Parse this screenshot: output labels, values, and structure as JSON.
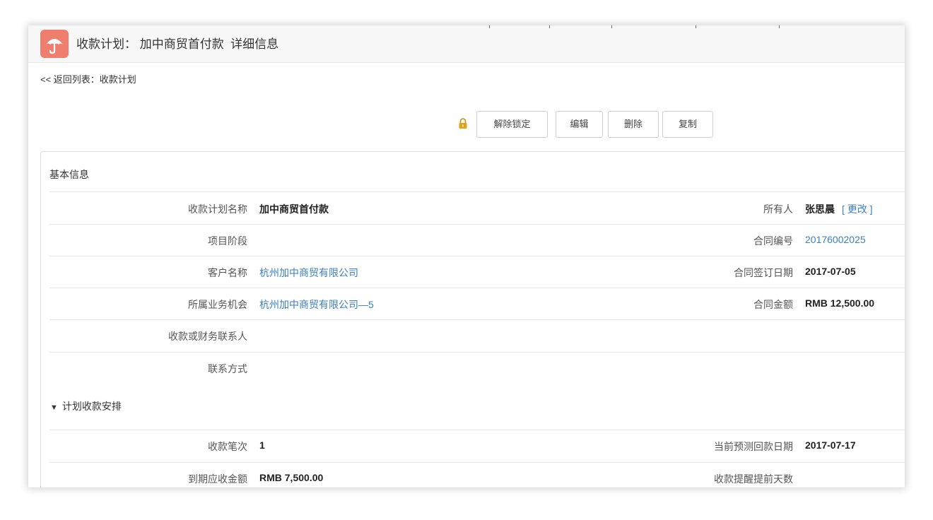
{
  "page": {
    "title": "收款计划： 加中商贸首付款  详细信息",
    "back_link": "<< 返回列表：收款计划"
  },
  "toolbar": {
    "unlock_label": "解除锁定",
    "edit_label": "编辑",
    "delete_label": "删除",
    "copy_label": "复制"
  },
  "basic_info": {
    "title": "基本信息",
    "plan_name_label": "收款计划名称",
    "plan_name_value": "加中商贸首付款",
    "owner_label": "所有人",
    "owner_value": "张思晨",
    "owner_change": "[ 更改 ]",
    "stage_label": "项目阶段",
    "stage_value": "",
    "contract_no_label": "合同编号",
    "contract_no_value": "20176002025",
    "customer_label": "客户名称",
    "customer_value": "杭州加中商贸有限公司",
    "sign_date_label": "合同签订日期",
    "sign_date_value": "2017-07-05",
    "opportunity_label": "所属业务机会",
    "opportunity_value": "杭州加中商贸有限公司—5",
    "amount_label": "合同金额",
    "amount_value": "RMB 12,500.00",
    "contact_label": "收款或财务联系人",
    "contact_value": "",
    "contact_method_label": "联系方式",
    "contact_method_value": ""
  },
  "schedule": {
    "title": "计划收款安排",
    "installment_label": "收款笔次",
    "installment_value": "1",
    "forecast_date_label": "当前预测回款日期",
    "forecast_date_value": "2017-07-17",
    "due_amount_label": "到期应收金额",
    "due_amount_value": "RMB 7,500.00",
    "reminder_days_label": "收款提醒提前天数",
    "reminder_days_value": ""
  },
  "colors": {
    "accent_icon": "#f07e6e",
    "link": "#3a7fc1",
    "lock": "#e0a21a"
  },
  "icons": {
    "app": "umbrella-icon",
    "lock": "lock-icon"
  }
}
